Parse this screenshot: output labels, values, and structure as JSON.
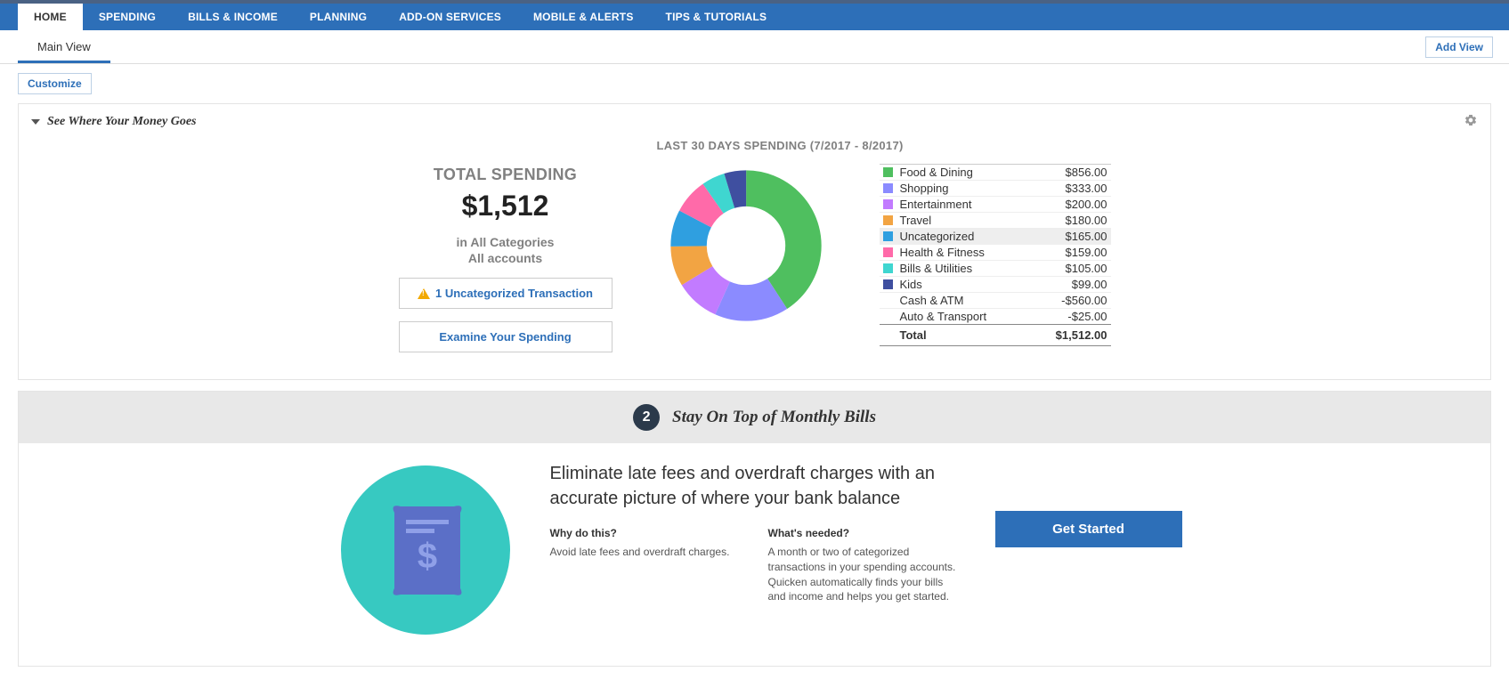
{
  "nav": {
    "items": [
      "HOME",
      "SPENDING",
      "BILLS & INCOME",
      "PLANNING",
      "ADD-ON SERVICES",
      "MOBILE & ALERTS",
      "TIPS & TUTORIALS"
    ],
    "active_index": 0
  },
  "subnav": {
    "tab": "Main View",
    "add_view": "Add View"
  },
  "customize_btn": "Customize",
  "panel1": {
    "title": "See Where Your Money Goes",
    "total_label": "TOTAL SPENDING",
    "total_amount": "$1,512",
    "sub1": "in All Categories",
    "sub2": "All accounts",
    "uncat_btn": "1 Uncategorized Transaction",
    "examine_btn": "Examine Your Spending",
    "chart_title": "LAST 30 DAYS SPENDING (7/2017 - 8/2017)"
  },
  "chart_data": {
    "type": "pie",
    "title": "LAST 30 DAYS SPENDING (7/2017 - 8/2017)",
    "series": [
      {
        "name": "Food & Dining",
        "value": 856.0,
        "color": "#4fbf5f"
      },
      {
        "name": "Shopping",
        "value": 333.0,
        "color": "#8b8bff"
      },
      {
        "name": "Entertainment",
        "value": 200.0,
        "color": "#c27bff"
      },
      {
        "name": "Travel",
        "value": 180.0,
        "color": "#f2a443"
      },
      {
        "name": "Uncategorized",
        "value": 165.0,
        "color": "#2f9fe0",
        "highlight": true
      },
      {
        "name": "Health & Fitness",
        "value": 159.0,
        "color": "#ff6aa9"
      },
      {
        "name": "Bills & Utilities",
        "value": 105.0,
        "color": "#3fd6d0"
      },
      {
        "name": "Kids",
        "value": 99.0,
        "color": "#3f4fa0"
      }
    ],
    "extras": [
      {
        "name": "Cash & ATM",
        "value": -560.0
      },
      {
        "name": "Auto & Transport",
        "value": -25.0
      }
    ],
    "total_label": "Total",
    "total_value": "$1,512.00"
  },
  "panel2": {
    "step": "2",
    "title": "Stay On Top of Monthly Bills",
    "headline": "Eliminate late fees and overdraft charges with an accurate picture of where your bank balance",
    "col1_title": "Why do this?",
    "col1_body": "Avoid late fees and overdraft charges.",
    "col2_title": "What's needed?",
    "col2_body": "A month or two of categorized transactions in your spending accounts. Quicken automatically finds your bills and income and helps you get started.",
    "cta": "Get Started"
  }
}
